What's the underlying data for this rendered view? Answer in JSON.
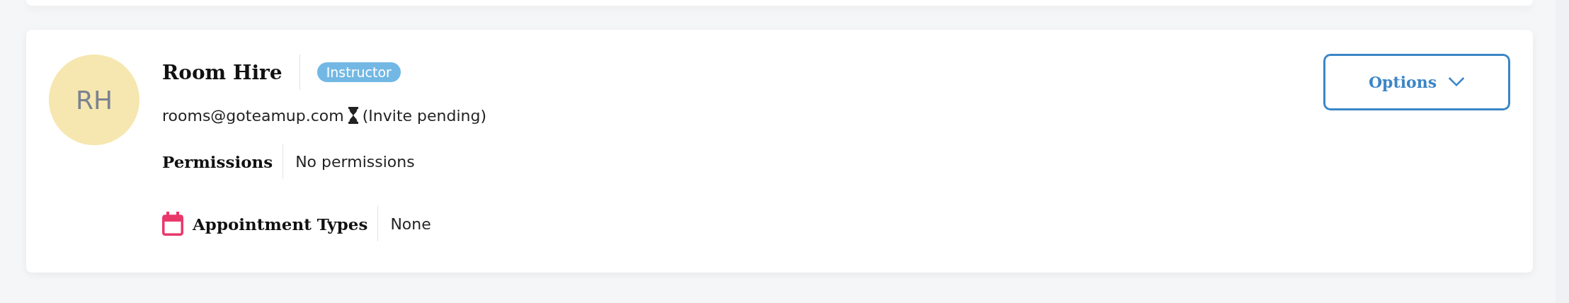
{
  "member": {
    "initials": "RH",
    "name": "Room Hire",
    "role": "Instructor",
    "email": "rooms@goteamup.com",
    "pending": true,
    "status": "(Invite pending)"
  },
  "details": [
    {
      "kind": "plain",
      "label": "Permissions",
      "value": "No permissions"
    },
    {
      "kind": "calendar",
      "label": "Appointment Types",
      "value": "None"
    }
  ],
  "options_button": {
    "label": "Options"
  }
}
